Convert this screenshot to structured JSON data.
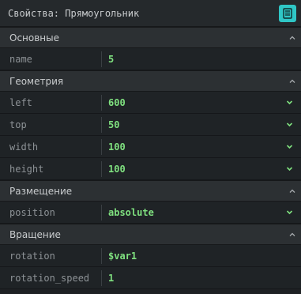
{
  "panel": {
    "title": "Свойства: Прямоугольник",
    "title_button_icon": "list-document-icon"
  },
  "colors": {
    "accent": "#2fc6c6",
    "value": "#7fe07f",
    "label": "#8d9296",
    "background": "#1e2124"
  },
  "sections": [
    {
      "title": "Основные",
      "rows": [
        {
          "label": "name",
          "value": "5",
          "kind": "input"
        }
      ]
    },
    {
      "title": "Геометрия",
      "rows": [
        {
          "label": "left",
          "value": "600",
          "kind": "select"
        },
        {
          "label": "top",
          "value": "50",
          "kind": "select"
        },
        {
          "label": "width",
          "value": "100",
          "kind": "select"
        },
        {
          "label": "height",
          "value": "100",
          "kind": "select"
        }
      ]
    },
    {
      "title": "Размещение",
      "rows": [
        {
          "label": "position",
          "value": "absolute",
          "kind": "select"
        }
      ]
    },
    {
      "title": "Вращение",
      "rows": [
        {
          "label": "rotation",
          "value": "$var1",
          "kind": "input"
        },
        {
          "label": "rotation_speed",
          "value": "1",
          "kind": "input"
        }
      ]
    }
  ]
}
